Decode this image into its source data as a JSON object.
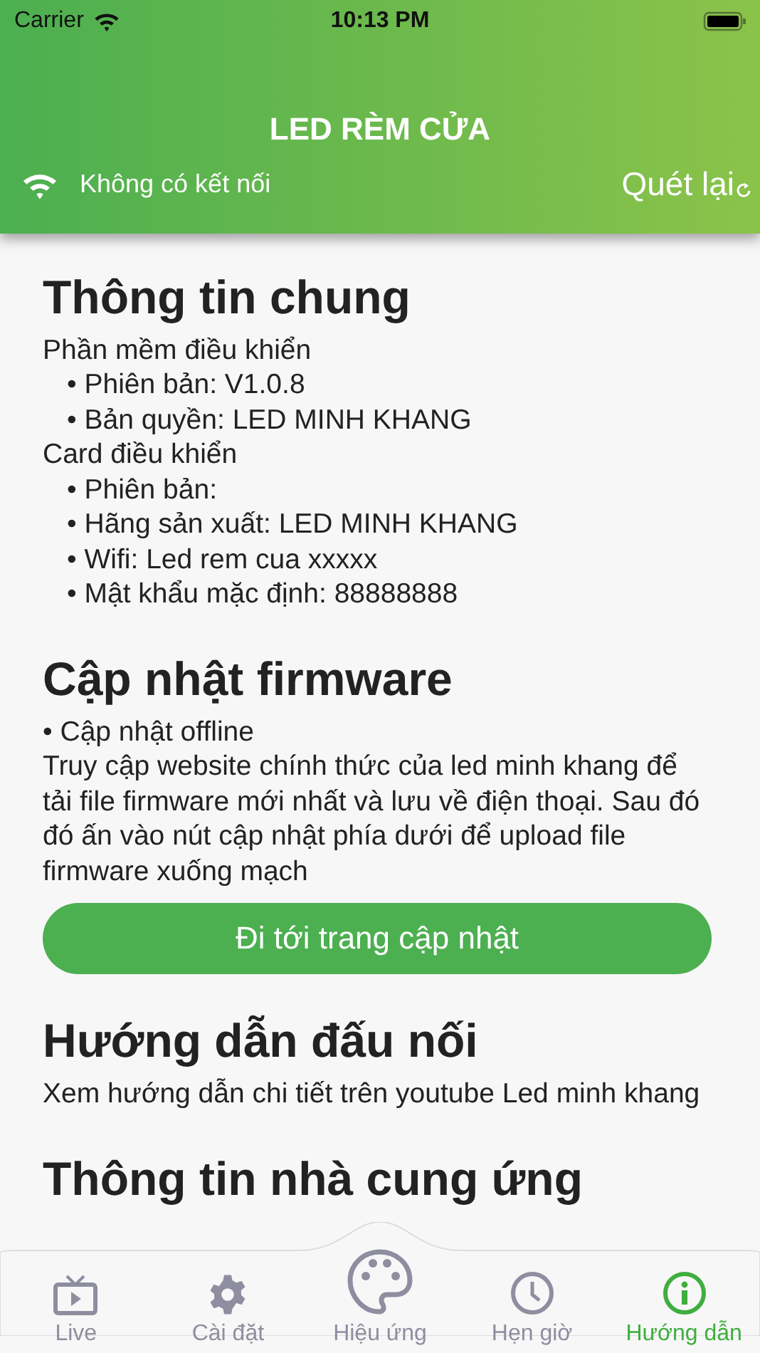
{
  "status_bar": {
    "carrier": "Carrier",
    "time": "10:13 PM"
  },
  "header": {
    "title": "LED RÈM CỬA",
    "connection": "Không có kết nối",
    "rescan": "Quét lại"
  },
  "sections": [
    {
      "title": "Thông tin chung",
      "blocks": [
        {
          "kind": "text",
          "text": "Phần mềm điều khiển"
        },
        {
          "kind": "bullet",
          "text": "• Phiên bản: V1.0.8"
        },
        {
          "kind": "bullet",
          "text": "• Bản quyền: LED MINH KHANG"
        },
        {
          "kind": "text",
          "text": "Card điều khiển"
        },
        {
          "kind": "bullet",
          "text": "• Phiên bản:"
        },
        {
          "kind": "bullet",
          "text": "• Hãng sản xuất: LED MINH KHANG"
        },
        {
          "kind": "bullet",
          "text": "• Wifi: Led rem cua xxxxx"
        },
        {
          "kind": "bullet",
          "text": "• Mật khẩu mặc định: 88888888"
        }
      ]
    },
    {
      "title": "Cập nhật firmware",
      "blocks": [
        {
          "kind": "plain",
          "text": "• Cập nhật offline"
        },
        {
          "kind": "plain",
          "text": "Truy cập website chính thức của led minh khang để tải file firmware mới nhất và lưu về điện thoại. Sau đó đó ấn vào nút cập nhật phía dưới để upload file firmware xuống mạch"
        },
        {
          "kind": "button",
          "text": "Đi tới trang cập nhật"
        }
      ]
    },
    {
      "title": "Hướng dẫn đấu nối",
      "blocks": [
        {
          "kind": "plain",
          "text": "Xem hướng dẫn chi tiết trên youtube Led minh khang"
        }
      ]
    },
    {
      "title": "Thông tin nhà cung ứng"
    }
  ],
  "tabs": [
    {
      "label": "Live",
      "selected": false
    },
    {
      "label": "Cài đặt",
      "selected": false
    },
    {
      "label": "Hiệu ứng",
      "selected": false
    },
    {
      "label": "Hẹn giờ",
      "selected": false
    },
    {
      "label": "Hướng dẫn",
      "selected": true
    }
  ]
}
